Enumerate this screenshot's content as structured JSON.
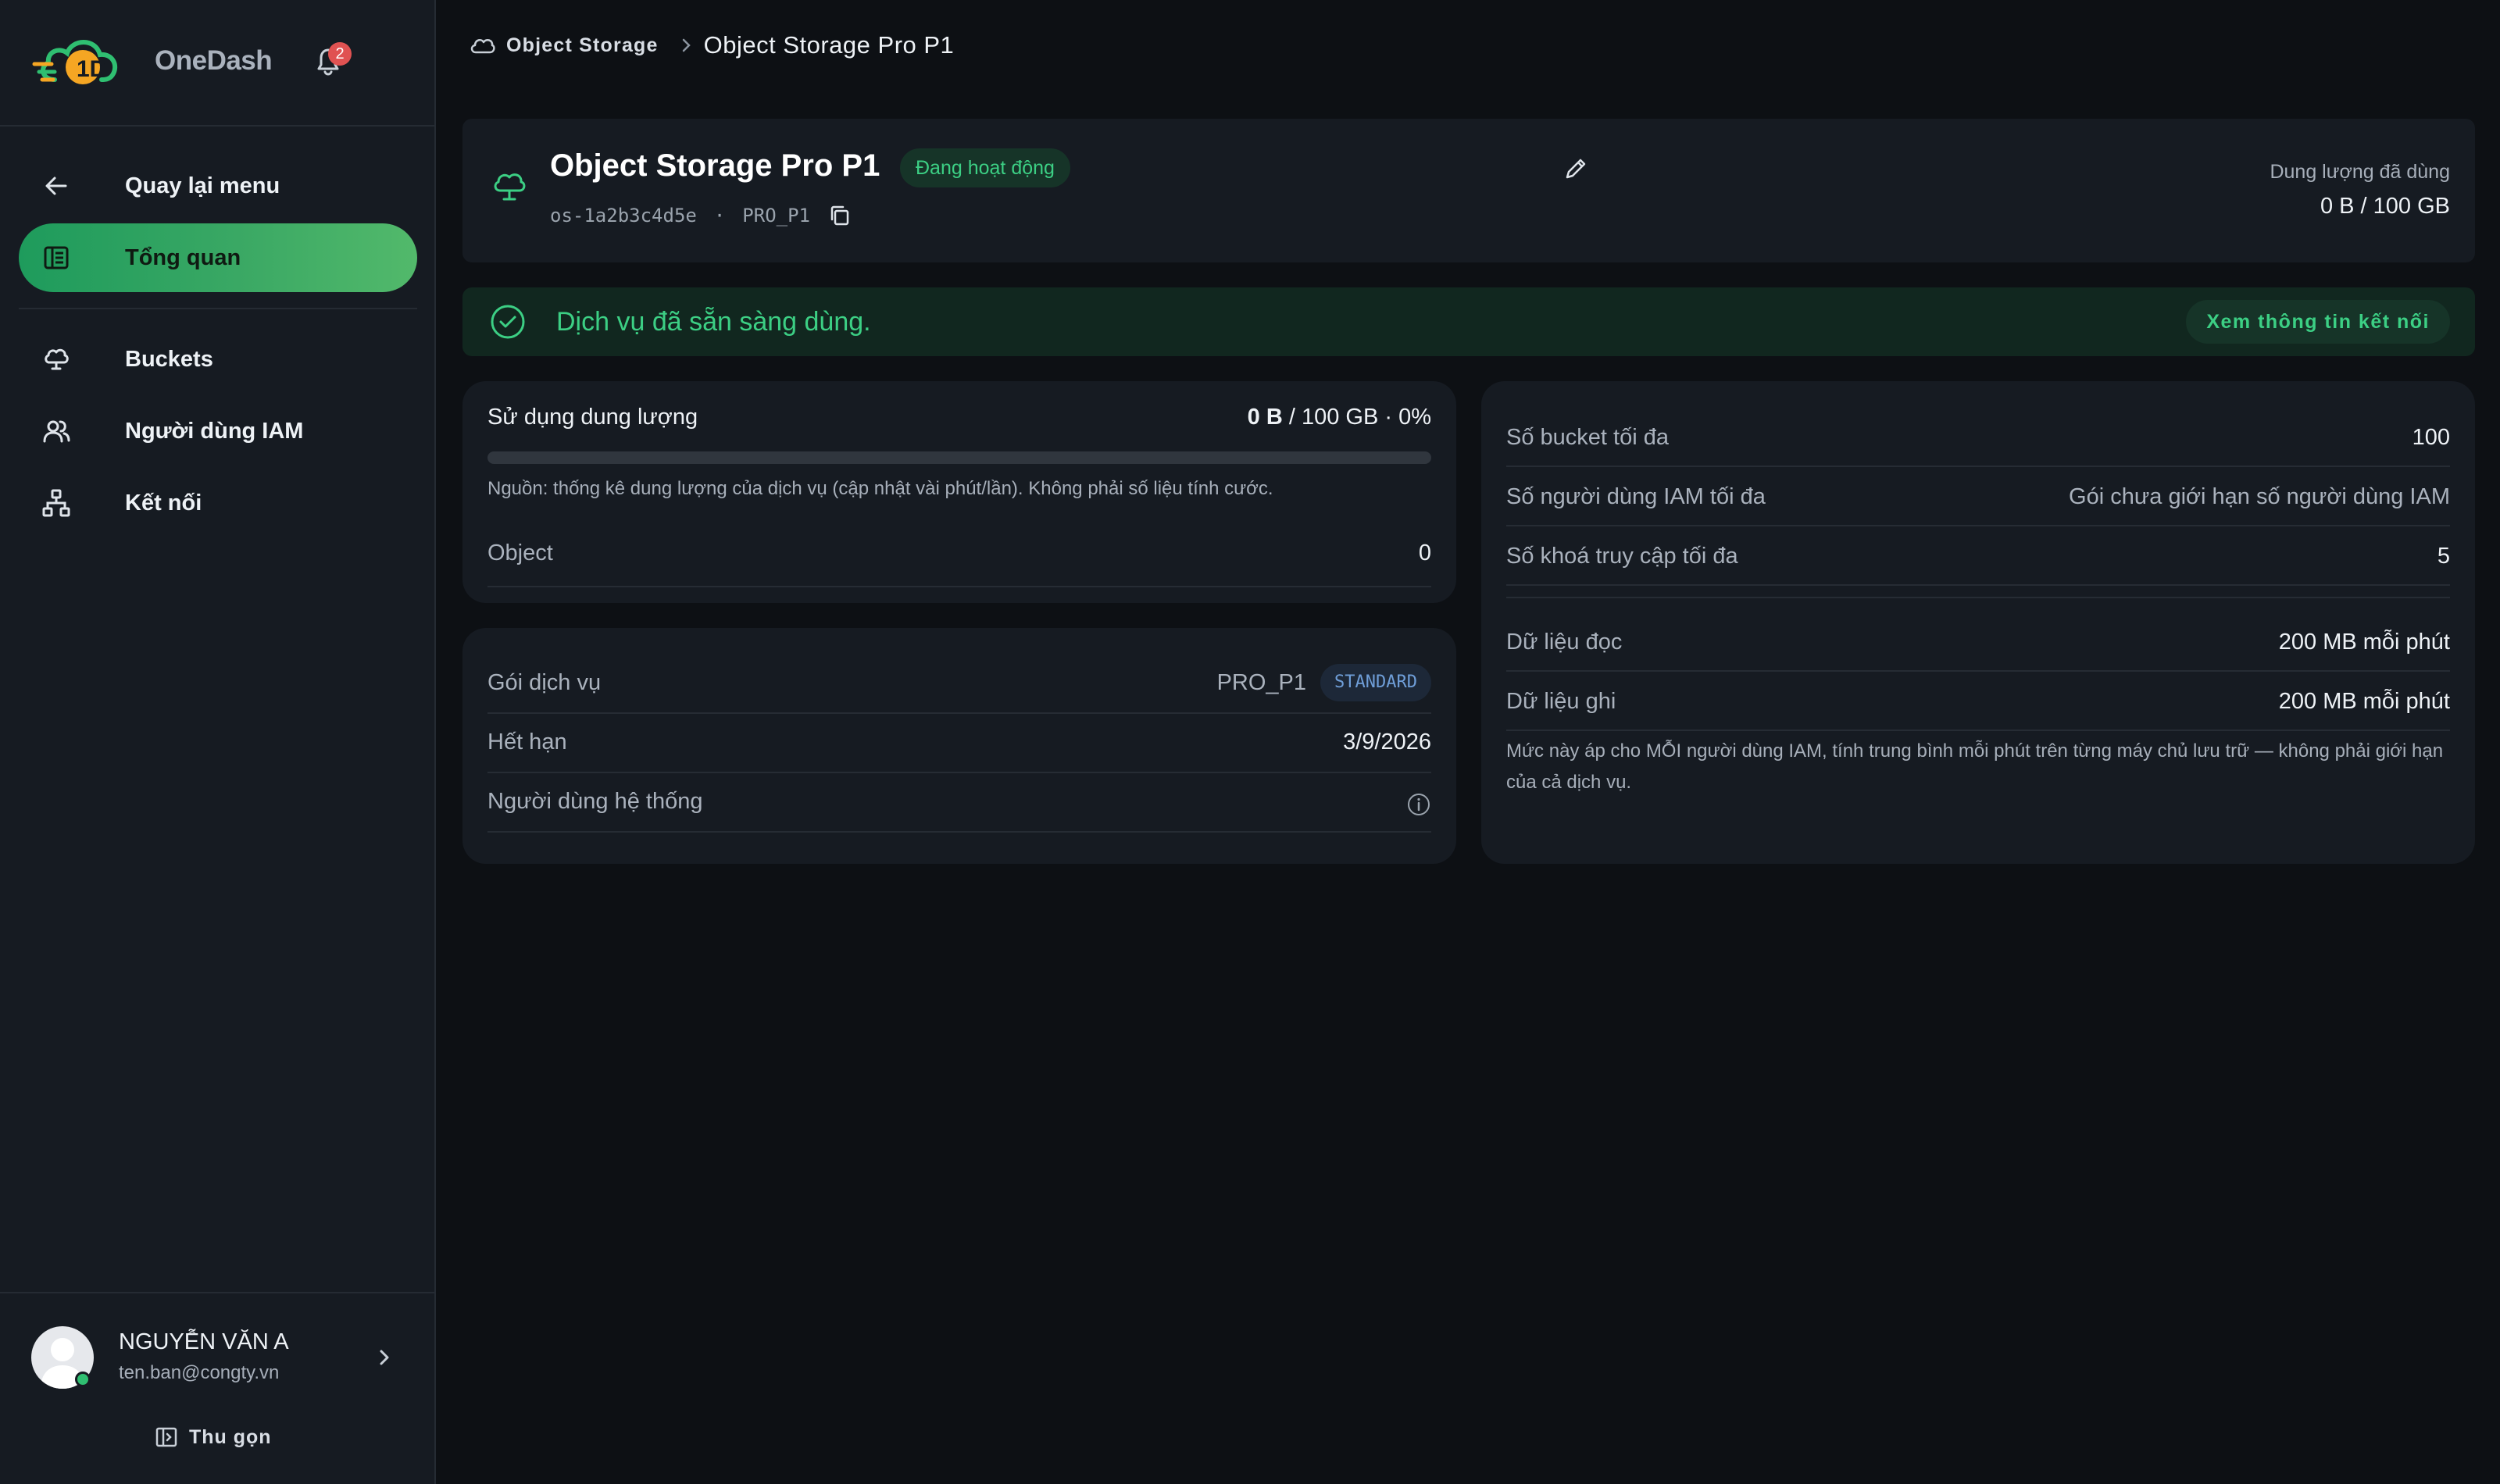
{
  "app": {
    "name": "OneDash",
    "notification_count": "2",
    "logo_text": "1D"
  },
  "sidebar": {
    "back_label": "Quay lại menu",
    "items": [
      {
        "label": "Tổng quan",
        "icon": "overview-icon",
        "active": true
      },
      {
        "label": "Buckets",
        "icon": "bucket-cloud-icon",
        "active": false
      },
      {
        "label": "Người dùng IAM",
        "icon": "users-icon",
        "active": false
      },
      {
        "label": "Kết nối",
        "icon": "network-icon",
        "active": false
      }
    ],
    "user": {
      "name": "NGUYỄN VĂN A",
      "email": "ten.ban@congty.vn",
      "status": "online"
    },
    "collapse_label": "Thu gọn"
  },
  "breadcrumb": {
    "parent": "Object Storage",
    "current": "Object Storage Pro P1"
  },
  "service": {
    "title": "Object Storage Pro P1",
    "status": "Đang hoạt động",
    "id": "os-1a2b3c4d5e",
    "plan_code": "PRO_P1",
    "sub_separator": "·",
    "usage_label": "Dung lượng đã dùng",
    "usage_value": "0 B / 100 GB"
  },
  "banner": {
    "text": "Dịch vụ đã sẵn sàng dùng.",
    "button_label": "Xem thông tin kết nối"
  },
  "usage": {
    "title": "Sử dụng dung lượng",
    "used": "0 B",
    "rest": " / 100 GB · 0%",
    "percent": 0,
    "note": "Nguồn: thống kê dung lượng của dịch vụ (cập nhật vài phút/lần). Không phải số liệu tính cước.",
    "object_label": "Object",
    "object_value": "0"
  },
  "plan": {
    "package_label": "Gói dịch vụ",
    "package_value": "PRO_P1",
    "tier": "STANDARD",
    "expiry_label": "Hết hạn",
    "expiry_value": "3/9/2026",
    "system_user_label": "Người dùng hệ thống"
  },
  "limits": {
    "rows": [
      {
        "label": "Số bucket tối đa",
        "value": "100"
      },
      {
        "label": "Số người dùng IAM tối đa",
        "value": "Gói chưa giới hạn số người dùng IAM"
      },
      {
        "label": "Số khoá truy cập tối đa",
        "value": "5"
      }
    ],
    "rate_rows": [
      {
        "label": "Dữ liệu đọc",
        "value": "200 MB mỗi phút"
      },
      {
        "label": "Dữ liệu ghi",
        "value": "200 MB mỗi phút"
      }
    ],
    "note": "Mức này áp cho MỖI người dùng IAM, tính trung bình mỗi phút trên từng máy chủ lưu trữ — không phải giới hạn của cả dịch vụ."
  },
  "colors": {
    "accent": "#3ccf84",
    "active_nav_start": "#1e9b5c",
    "active_nav_end": "#52b96b",
    "logo_orange": "#f5a623",
    "badge_red": "#e05252",
    "tier_blue": "#6f9ed8"
  }
}
